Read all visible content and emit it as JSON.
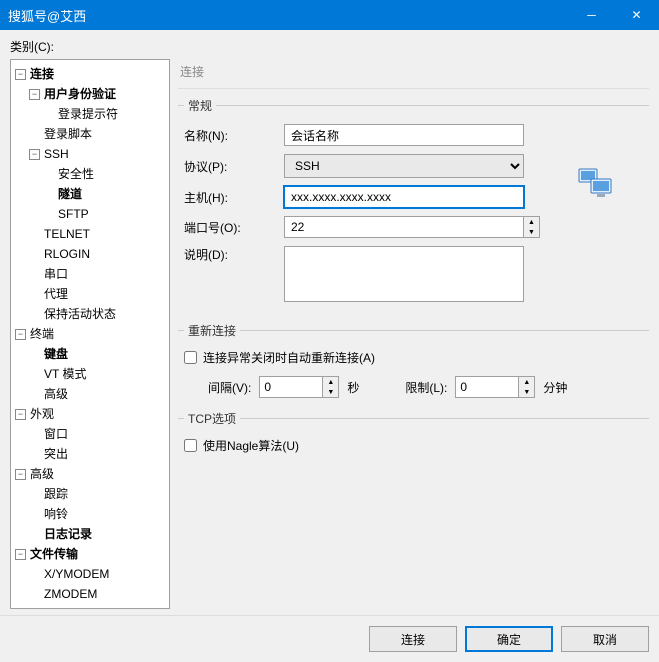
{
  "window": {
    "title": "搜狐号@艾西"
  },
  "category_label": "类别(C):",
  "tree": {
    "connection": "连接",
    "user_auth": "用户身份验证",
    "login_prompt": "登录提示符",
    "login_script": "登录脚本",
    "ssh": "SSH",
    "security": "安全性",
    "tunnel": "隧道",
    "sftp": "SFTP",
    "telnet": "TELNET",
    "rlogin": "RLOGIN",
    "serial": "串口",
    "proxy": "代理",
    "keep_alive": "保持活动状态",
    "terminal": "终端",
    "keyboard": "键盘",
    "vt_mode": "VT 模式",
    "advanced_term": "高级",
    "appearance": "外观",
    "window": "窗口",
    "highlight": "突出",
    "advanced": "高级",
    "trace": "跟踪",
    "bell": "响铃",
    "log": "日志记录",
    "file_transfer": "文件传输",
    "xymodem": "X/YMODEM",
    "zmodem": "ZMODEM"
  },
  "crumb": "连接",
  "general": {
    "legend": "常规",
    "name_lbl": "名称(N):",
    "name_val": "会话名称",
    "proto_lbl": "协议(P):",
    "proto_val": "SSH",
    "host_lbl": "主机(H):",
    "host_val": "xxx.xxxx.xxxx.xxxx",
    "port_lbl": "端口号(O):",
    "port_val": "22",
    "desc_lbl": "说明(D):",
    "desc_val": ""
  },
  "reconnect": {
    "legend": "重新连接",
    "auto_lbl": "连接异常关闭时自动重新连接(A)",
    "interval_lbl": "间隔(V):",
    "interval_val": "0",
    "sec": "秒",
    "limit_lbl": "限制(L):",
    "limit_val": "0",
    "min": "分钟"
  },
  "tcp": {
    "legend": "TCP选项",
    "nagle_lbl": "使用Nagle算法(U)"
  },
  "footer": {
    "connect": "连接",
    "ok": "确定",
    "cancel": "取消"
  }
}
